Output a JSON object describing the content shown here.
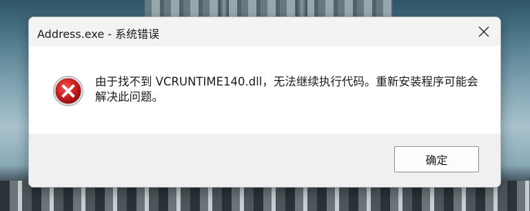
{
  "dialog": {
    "title": "Address.exe - 系统错误",
    "message": "由于找不到 VCRUNTIME140.dll，无法继续执行代码。重新安装程序可能会解决此问题。",
    "ok_label": "确定",
    "icon": "error-icon",
    "accent_color": "#c8171a"
  }
}
